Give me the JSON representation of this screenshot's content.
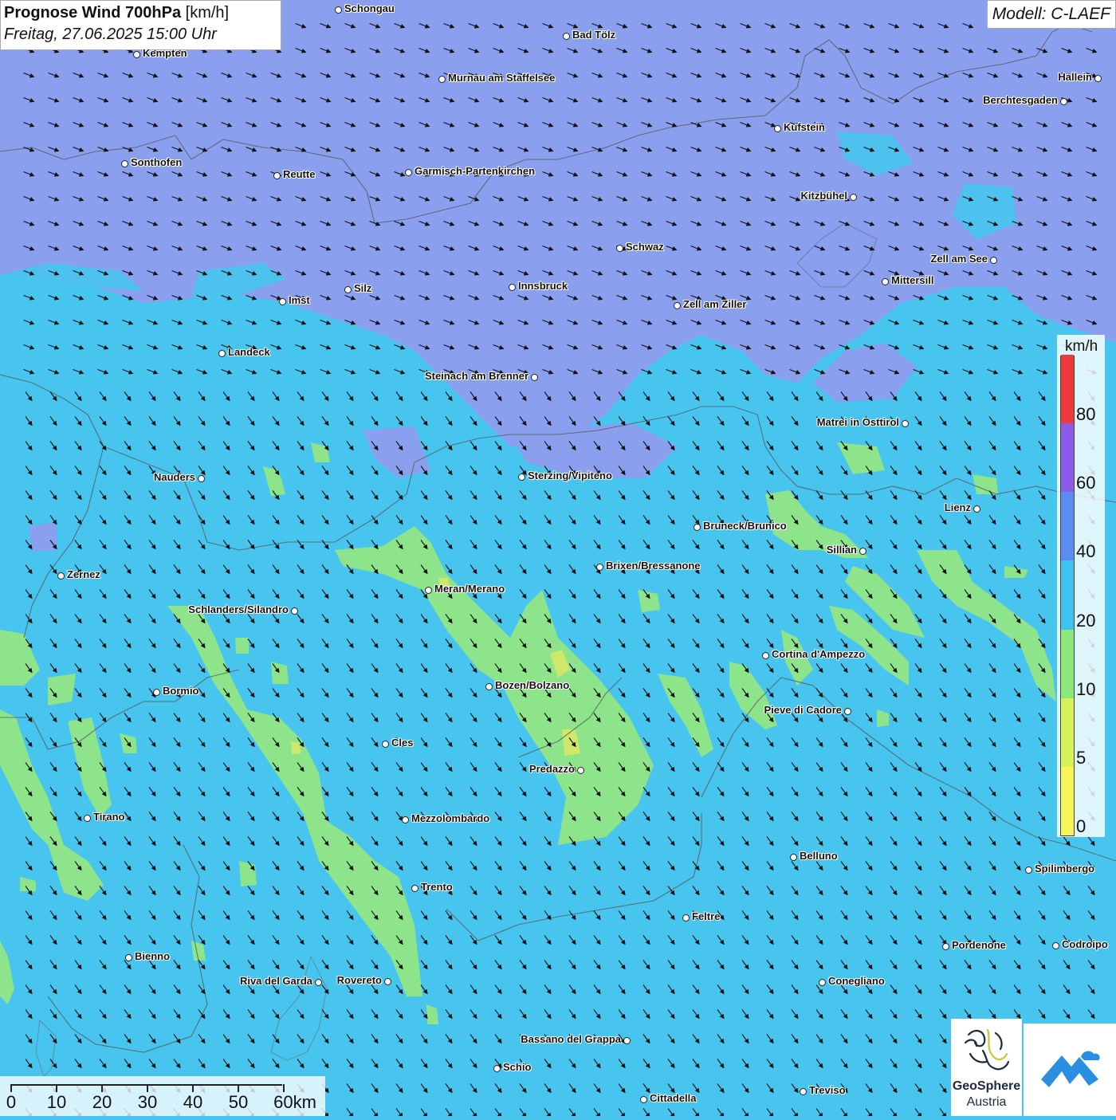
{
  "header": {
    "title": "Prognose Wind 700hPa",
    "unit": "[km/h]",
    "datetime": "Freitag, 27.06.2025 15:00 Uhr",
    "model": "Modell: C-LAEF"
  },
  "legend": {
    "unit": "km/h",
    "classes": [
      {
        "label": "0",
        "color": "#f7f45a"
      },
      {
        "label": "5",
        "color": "#d6f25a"
      },
      {
        "label": "10",
        "color": "#8be87a"
      },
      {
        "label": "20",
        "color": "#3ec3ee"
      },
      {
        "label": "40",
        "color": "#5a8cf2"
      },
      {
        "label": "60",
        "color": "#8a5ae8"
      },
      {
        "label": "80",
        "color": "#ee3a3a"
      }
    ]
  },
  "scale_bar": {
    "labels": [
      "0",
      "10",
      "20",
      "30",
      "40",
      "50",
      "60km"
    ]
  },
  "logos": {
    "geosphere_name": "GeoSphere",
    "geosphere_country": "Austria"
  },
  "field_colors": {
    "band_30_40": "#8aa0ee",
    "band_20_30": "#47c5ee",
    "band_10_20": "#8de48a",
    "band_5_10": "#cfe86a",
    "arrow": "#111111"
  },
  "wind": {
    "direction": "NW",
    "arrow_icon": "wind-arrow-icon"
  },
  "cities": [
    {
      "name": "Schongau"
    },
    {
      "name": "Bad Tölz"
    },
    {
      "name": "Kempten"
    },
    {
      "name": "Murnau am Staffelsee"
    },
    {
      "name": "Hallein"
    },
    {
      "name": "Berchtesgaden"
    },
    {
      "name": "Kufstein"
    },
    {
      "name": "Sonthofen"
    },
    {
      "name": "Reutte"
    },
    {
      "name": "Garmisch-Partenkirchen"
    },
    {
      "name": "Kitzbühel"
    },
    {
      "name": "Schwaz"
    },
    {
      "name": "Zell am See"
    },
    {
      "name": "Mittersill"
    },
    {
      "name": "Innsbruck"
    },
    {
      "name": "Silz"
    },
    {
      "name": "Imst"
    },
    {
      "name": "Zell am Ziller"
    },
    {
      "name": "Landeck"
    },
    {
      "name": "Steinach am Brenner"
    },
    {
      "name": "Matrei in Osttirol"
    },
    {
      "name": "Nauders"
    },
    {
      "name": "Sterzing/Vipiteno"
    },
    {
      "name": "Lienz"
    },
    {
      "name": "Bruneck/Brunico"
    },
    {
      "name": "Sillian"
    },
    {
      "name": "Brixen/Bressanone"
    },
    {
      "name": "Zernez"
    },
    {
      "name": "Meran/Merano"
    },
    {
      "name": "Schlanders/Silandro"
    },
    {
      "name": "Cortina d'Ampezzo"
    },
    {
      "name": "Bozen/Bolzano"
    },
    {
      "name": "Bormio"
    },
    {
      "name": "Pieve di Cadore"
    },
    {
      "name": "Cles"
    },
    {
      "name": "Predazzo"
    },
    {
      "name": "Tirano"
    },
    {
      "name": "Mezzolombardo"
    },
    {
      "name": "Belluno"
    },
    {
      "name": "Spilimbergo"
    },
    {
      "name": "Trento"
    },
    {
      "name": "Feltre"
    },
    {
      "name": "Pordenone"
    },
    {
      "name": "Codroipo"
    },
    {
      "name": "Bienno"
    },
    {
      "name": "Riva del Garda"
    },
    {
      "name": "Rovereto"
    },
    {
      "name": "Conegliano"
    },
    {
      "name": "Bassano del Grappa"
    },
    {
      "name": "Schio"
    },
    {
      "name": "Treviso"
    },
    {
      "name": "Cittadella"
    }
  ]
}
